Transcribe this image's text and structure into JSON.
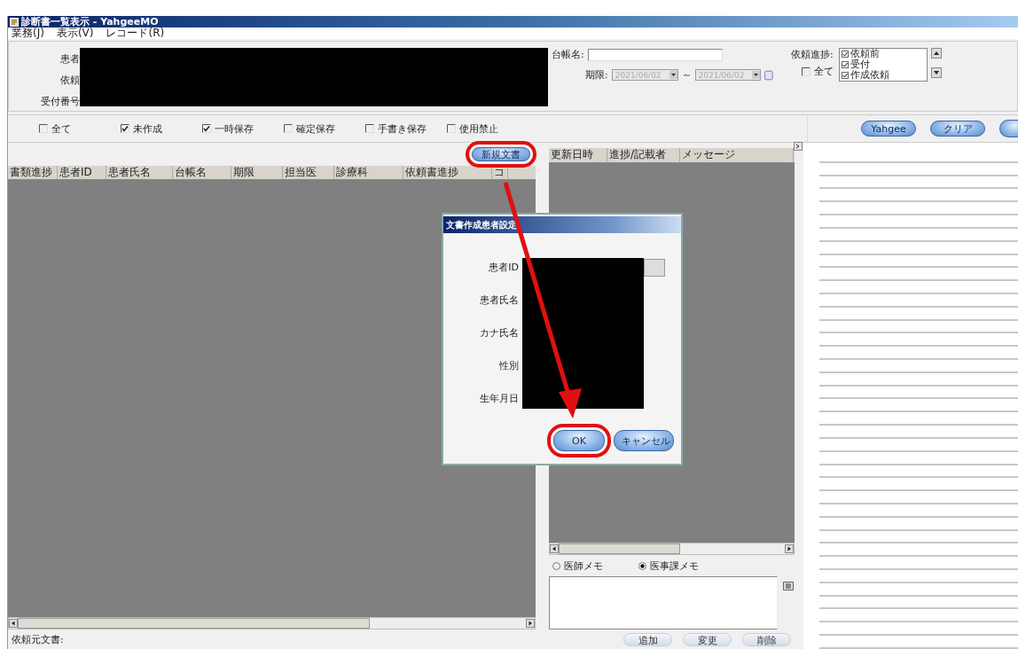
{
  "window": {
    "title": "診断書一覧表示 - YahgeeMO"
  },
  "menu": [
    "業務(J)",
    "表示(V)",
    "レコード(R)"
  ],
  "search_panel": {
    "field_labels": [
      "患者",
      "依頼",
      "受付番号"
    ],
    "ledger_label": "台帳名:",
    "deadline_label": "期限:",
    "date_from": {
      "value": "2021/06/02",
      "enabled": false
    },
    "date_separator": "～",
    "date_to": {
      "value": "2021/06/02",
      "enabled": false
    },
    "progress_label": "依頼進捗:",
    "progress_all": {
      "label": "全て",
      "checked": false
    },
    "progress_options": [
      {
        "label": "依頼前",
        "checked": true
      },
      {
        "label": "受付",
        "checked": true
      },
      {
        "label": "作成依頼",
        "checked": true
      }
    ]
  },
  "status_filters": [
    {
      "label": "全て",
      "checked": false
    },
    {
      "label": "未作成",
      "checked": true
    },
    {
      "label": "一時保存",
      "checked": true
    },
    {
      "label": "確定保存",
      "checked": false
    },
    {
      "label": "手書き保存",
      "checked": false
    },
    {
      "label": "使用禁止",
      "checked": false
    }
  ],
  "toolbar_buttons": [
    "Yahgee",
    "クリア"
  ],
  "new_document_button": {
    "label": "新規文書",
    "highlighted": true
  },
  "document_table": {
    "columns": [
      "書類進捗",
      "患者ID",
      "患者氏名",
      "台帳名",
      "期限",
      "担当医",
      "診療科",
      "依頼書進捗",
      "コ"
    ]
  },
  "history_table": {
    "columns": [
      "更新日時",
      "進捗/記載者",
      "メッセージ"
    ]
  },
  "memo_types": [
    {
      "label": "医師メモ",
      "selected": false
    },
    {
      "label": "医事課メモ",
      "selected": true
    }
  ],
  "memo_buttons": [
    "追加",
    "変更",
    "削除"
  ],
  "status_bar": {
    "label": "依頼元文書:"
  },
  "dialog": {
    "title": "文書作成患者設定",
    "field_labels": [
      "患者ID",
      "患者氏名",
      "カナ氏名",
      "性別",
      "生年月日"
    ],
    "buttons": [
      {
        "label": "OK",
        "highlighted": true
      },
      {
        "label": "キャンセル",
        "highlighted": false
      }
    ]
  }
}
